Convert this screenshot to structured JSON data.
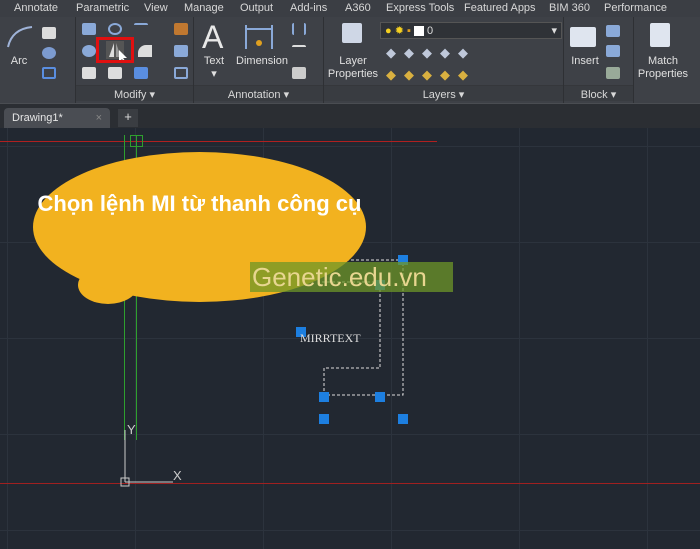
{
  "menu_tabs": [
    "Annotate",
    "Parametric",
    "View",
    "Manage",
    "Output",
    "Add-ins",
    "A360",
    "Express Tools",
    "Featured Apps",
    "BIM 360",
    "Performance"
  ],
  "ribbon": {
    "draw": {
      "arc_label": "Arc"
    },
    "modify": {
      "label": "Modify",
      "highlighted_tool": "mirror",
      "highlight_color": "#e01010"
    },
    "annotation": {
      "label": "Annotation",
      "text_label": "Text",
      "dimension_label": "Dimension"
    },
    "layers": {
      "label": "Layers",
      "layer_properties_label": "Layer Properties",
      "current_layer": "0"
    },
    "block": {
      "label": "Block",
      "insert_label": "Insert"
    },
    "properties": {
      "match_properties_label": "Match Properties"
    }
  },
  "tabs": {
    "document": "Drawing1*",
    "close": "×",
    "new": "+"
  },
  "canvas": {
    "callout": "Chọn lệnh MI từ thanh công cụ",
    "callout_color": "#f2b21f",
    "watermark": "Genetic.edu.vn",
    "text_object": "MIRRTEXT",
    "ucs": {
      "y": "Y",
      "x": "X"
    }
  }
}
